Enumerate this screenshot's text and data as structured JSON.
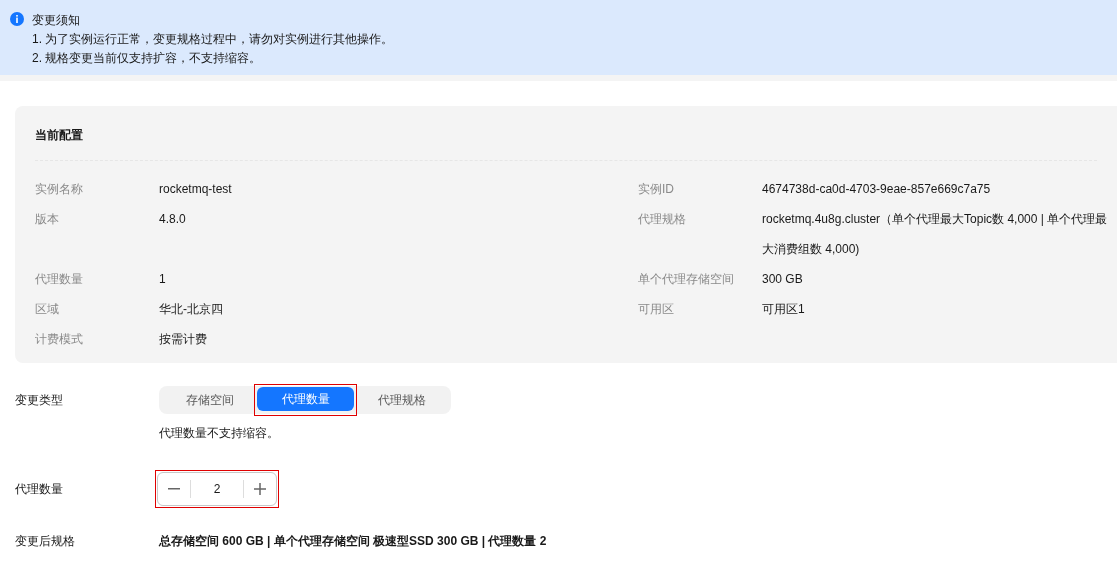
{
  "notice": {
    "title": "变更须知",
    "lines": [
      "1. 为了实例运行正常，变更规格过程中，请勿对实例进行其他操作。",
      "2. 规格变更当前仅支持扩容，不支持缩容。"
    ]
  },
  "current_config": {
    "title": "当前配置",
    "rows": [
      {
        "left": {
          "label": "实例名称",
          "value": "rocketmq-test"
        },
        "right": {
          "label": "实例ID",
          "value": "4674738d-ca0d-4703-9eae-857e669c7a75"
        }
      },
      {
        "left": {
          "label": "版本",
          "value": "4.8.0"
        },
        "right": {
          "label": "代理规格",
          "value": "rocketmq.4u8g.cluster（单个代理最大Topic数 4,000 | 单个代理最大消费组数 4,000)"
        }
      },
      {
        "left": {
          "label": "代理数量",
          "value": "1"
        },
        "right": {
          "label": "单个代理存储空间",
          "value": "300 GB"
        }
      },
      {
        "left": {
          "label": "区域",
          "value": "华北-北京四"
        },
        "right": {
          "label": "可用区",
          "value": "可用区1"
        }
      },
      {
        "left": {
          "label": "计费模式",
          "value": "按需计费"
        }
      }
    ]
  },
  "change_type": {
    "label": "变更类型",
    "tabs": [
      {
        "label": "存储空间",
        "selected": false,
        "highlighted": false
      },
      {
        "label": "代理数量",
        "selected": true,
        "highlighted": true
      },
      {
        "label": "代理规格",
        "selected": false,
        "highlighted": false
      }
    ],
    "hint": "代理数量不支持缩容。"
  },
  "broker_count": {
    "label": "代理数量",
    "value": "2",
    "highlighted": true
  },
  "new_spec": {
    "label": "变更后规格",
    "value": "总存储空间 600 GB | 单个代理存储空间 极速型SSD 300 GB | 代理数量 2"
  }
}
